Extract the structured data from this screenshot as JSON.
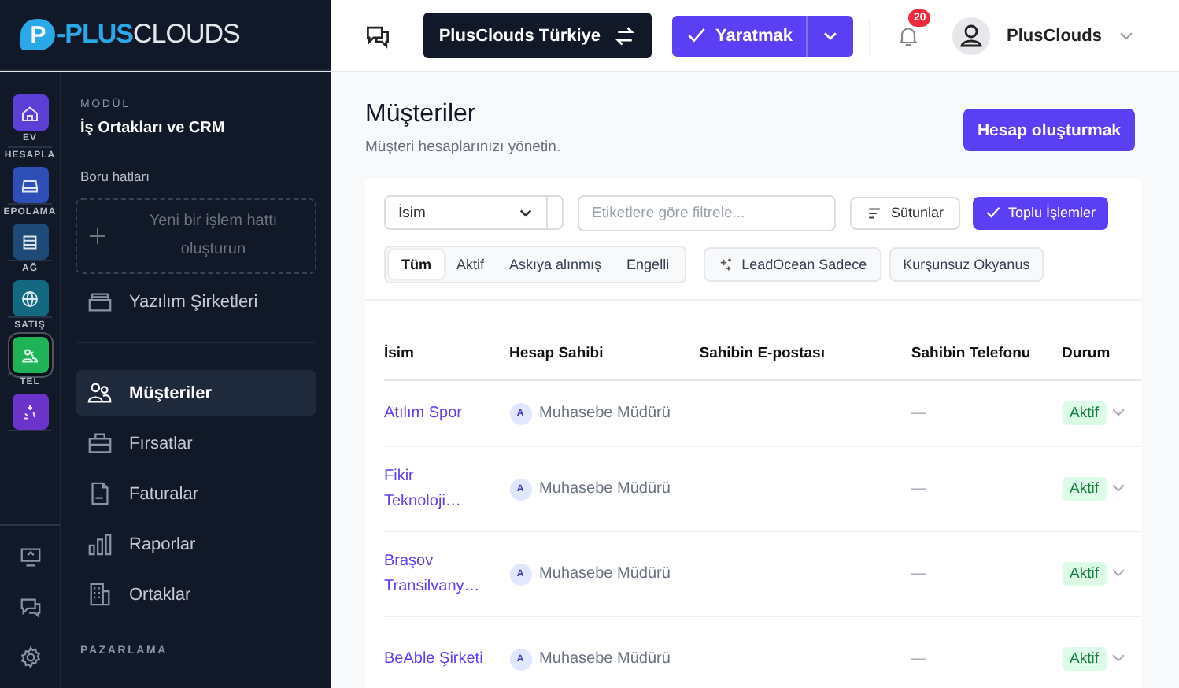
{
  "logo": {
    "mark": "P",
    "brand": "-PLUS",
    "brand2": "CLOUDS"
  },
  "topbar": {
    "org": "PlusClouds Türkiye",
    "create": "Yaratmak",
    "notifications": "20",
    "user": "PlusClouds"
  },
  "rail": [
    {
      "label": "EV",
      "color": "#5b3fd6",
      "selected": false
    },
    {
      "label": "HESAPLA",
      "color": "#2e4fb5",
      "selected": false
    },
    {
      "label": "EPOLAMA",
      "color": "#1e4a78",
      "selected": false
    },
    {
      "label": "AĞ",
      "color": "#136a80",
      "selected": false
    },
    {
      "label": "SATIŞ",
      "color": "#1fb256",
      "selected": true
    },
    {
      "label": "TEL",
      "color": "#6b33c9",
      "selected": false
    }
  ],
  "panel": {
    "module_label": "MODÜL",
    "module": "İş Ortakları ve CRM",
    "pipelines_label": "Boru hatları",
    "new_pipeline": "Yeni bir işlem hattı oluşturun",
    "pipelines": [
      {
        "label": "Yazılım Şirketleri",
        "selected": false
      }
    ],
    "items": [
      {
        "label": "Müşteriler",
        "selected": true
      },
      {
        "label": "Fırsatlar",
        "selected": false
      },
      {
        "label": "Faturalar",
        "selected": false
      },
      {
        "label": "Raporlar",
        "selected": false
      },
      {
        "label": "Ortaklar",
        "selected": false
      }
    ],
    "section": "PAZARLAMA"
  },
  "page": {
    "title": "Müşteriler",
    "subtitle": "Müşteri hesaplarınızı yönetin.",
    "action": "Hesap oluşturmak"
  },
  "filters": {
    "field": "İsim",
    "tag_placeholder": "Etiketlere göre filtrele...",
    "columns": "Sütunlar",
    "bulk": "Toplu İşlemler",
    "tabs": [
      {
        "label": "Tüm",
        "selected": true
      },
      {
        "label": "Aktif",
        "selected": false
      },
      {
        "label": "Askıya alınmış",
        "selected": false
      },
      {
        "label": "Engelli",
        "selected": false
      }
    ],
    "chips": [
      {
        "label": "LeadOcean Sadece",
        "kind": "ai"
      },
      {
        "label": "Kurşunsuz Okyanus",
        "kind": "plain"
      }
    ]
  },
  "table": {
    "columns": [
      "İsim",
      "Hesap Sahibi",
      "Sahibin E-postası",
      "Sahibin Telefonu",
      "Durum"
    ],
    "rows": [
      {
        "name": "Atılım Spor",
        "owner_initial": "A",
        "owner": "Muhasebe Müdürü",
        "phone": "—",
        "status": "Aktif"
      },
      {
        "name": "Fikir Teknoloji…",
        "owner_initial": "A",
        "owner": "Muhasebe Müdürü",
        "phone": "—",
        "status": "Aktif"
      },
      {
        "name": "Braşov Transilvany…",
        "owner_initial": "A",
        "owner": "Muhasebe Müdürü",
        "phone": "—",
        "status": "Aktif"
      },
      {
        "name": "BeAble Şirketi",
        "owner_initial": "A",
        "owner": "Muhasebe Müdürü",
        "phone": "—",
        "status": "Aktif"
      }
    ]
  }
}
